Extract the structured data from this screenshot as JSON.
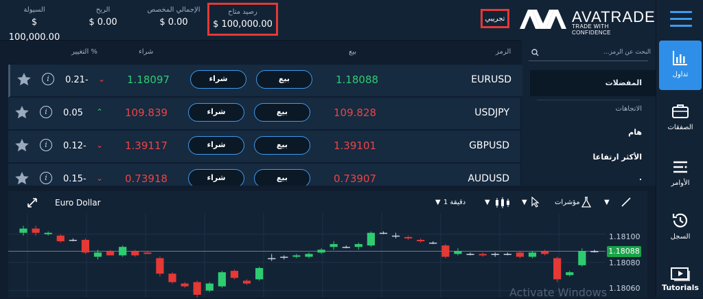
{
  "header": {
    "stats": [
      {
        "label": "السيولة",
        "value": "$ 100,000.00"
      },
      {
        "label": "الربح",
        "value": "$ 0.00"
      },
      {
        "label": "الإجمالي المخصص",
        "value": "$ 0.00"
      },
      {
        "label": "رصيد متاح",
        "value": "$ 100,000.00"
      }
    ],
    "demo_label": "تجريبي",
    "logo": {
      "brand": "AVATRADE",
      "tagline": "TRADE WITH CONFIDENCE"
    }
  },
  "nav": {
    "items": [
      {
        "label": "تداول",
        "icon": "bar-chart-icon"
      },
      {
        "label": "الصفقات",
        "icon": "briefcase-icon"
      },
      {
        "label": "الأوامر",
        "icon": "list-icon"
      },
      {
        "label": "السجل",
        "icon": "history-icon"
      },
      {
        "label": "Tutorials",
        "icon": "video-icon"
      }
    ]
  },
  "sidebar": {
    "search_placeholder": "البحث عن الرمز...",
    "favorites": "المفضلات",
    "trends_heading": "الاتجاهات",
    "items": [
      "هام",
      "الأكثر ارتفاعا",
      "."
    ]
  },
  "table": {
    "headers": {
      "symbol": "الرمز",
      "sell": "بيع",
      "buy": "شراء",
      "change": "التغيير %"
    },
    "buy_button": "شراء",
    "sell_button": "بيع",
    "rows": [
      {
        "symbol": "EURUSD",
        "sell": "1.18088",
        "buy": "1.18097",
        "change": "-0.21",
        "direction": "down",
        "color": "up"
      },
      {
        "symbol": "USDJPY",
        "sell": "109.828",
        "buy": "109.839",
        "change": "0.05",
        "direction": "up",
        "color": "down"
      },
      {
        "symbol": "GBPUSD",
        "sell": "1.39101",
        "buy": "1.39117",
        "change": "-0.12",
        "direction": "down",
        "color": "down"
      },
      {
        "symbol": "AUDUSD",
        "sell": "0.73907",
        "buy": "0.73918",
        "change": "-0.15",
        "direction": "down",
        "color": "down"
      }
    ]
  },
  "chart": {
    "title": "Euro Dollar",
    "timeframe": "1 دقيقة",
    "indicators_label": "مؤشرات",
    "current_price": "1.18088",
    "y_ticks": [
      "1.18100",
      "1.18080",
      "1.18060"
    ],
    "watermark": "Activate Windows",
    "colors": {
      "up": "#2ecc71",
      "down": "#e53935",
      "accent": "#3e9cf0"
    }
  },
  "chart_data": {
    "type": "candlestick",
    "title": "Euro Dollar",
    "y_ticks": [
      1.181,
      1.1808,
      1.1806
    ],
    "ylim": [
      1.18055,
      1.18115
    ],
    "current_price": 1.18088,
    "candles": [
      {
        "o": 1.18101,
        "c": 1.18104,
        "h": 1.18106,
        "l": 1.18099
      },
      {
        "o": 1.18104,
        "c": 1.18101,
        "h": 1.18106,
        "l": 1.18099
      },
      {
        "o": 1.181,
        "c": 1.18101,
        "h": 1.18102,
        "l": 1.18099
      },
      {
        "o": 1.18099,
        "c": 1.18095,
        "h": 1.181,
        "l": 1.18094
      },
      {
        "o": 1.18096,
        "c": 1.18096,
        "h": 1.18097,
        "l": 1.18095
      },
      {
        "o": 1.18096,
        "c": 1.18087,
        "h": 1.18097,
        "l": 1.18086
      },
      {
        "o": 1.18084,
        "c": 1.18087,
        "h": 1.18089,
        "l": 1.18082
      },
      {
        "o": 1.18088,
        "c": 1.18085,
        "h": 1.18089,
        "l": 1.18085
      },
      {
        "o": 1.18085,
        "c": 1.18091,
        "h": 1.18092,
        "l": 1.18084
      },
      {
        "o": 1.18088,
        "c": 1.18085,
        "h": 1.18089,
        "l": 1.18084
      },
      {
        "o": 1.18087,
        "c": 1.18086,
        "h": 1.18088,
        "l": 1.18086
      },
      {
        "o": 1.18083,
        "c": 1.18072,
        "h": 1.18084,
        "l": 1.1807
      },
      {
        "o": 1.18072,
        "c": 1.18066,
        "h": 1.18073,
        "l": 1.18065
      },
      {
        "o": 1.18065,
        "c": 1.18063,
        "h": 1.18066,
        "l": 1.18062
      },
      {
        "o": 1.18066,
        "c": 1.18057,
        "h": 1.18067,
        "l": 1.18055
      },
      {
        "o": 1.1806,
        "c": 1.18065,
        "h": 1.18066,
        "l": 1.18059
      },
      {
        "o": 1.18063,
        "c": 1.18073,
        "h": 1.18074,
        "l": 1.18062
      },
      {
        "o": 1.18074,
        "c": 1.18069,
        "h": 1.18075,
        "l": 1.18068
      },
      {
        "o": 1.18067,
        "c": 1.18065,
        "h": 1.18068,
        "l": 1.18064
      },
      {
        "o": 1.18068,
        "c": 1.18076,
        "h": 1.18077,
        "l": 1.18067
      },
      {
        "o": 1.18083,
        "c": 1.18083,
        "h": 1.18086,
        "l": 1.18081
      },
      {
        "o": 1.18084,
        "c": 1.18084,
        "h": 1.18085,
        "l": 1.18082
      },
      {
        "o": 1.18084,
        "c": 1.18085,
        "h": 1.18086,
        "l": 1.18083
      },
      {
        "o": 1.18084,
        "c": 1.18086,
        "h": 1.18087,
        "l": 1.18083
      },
      {
        "o": 1.18087,
        "c": 1.18089,
        "h": 1.1809,
        "l": 1.18086
      },
      {
        "o": 1.18091,
        "c": 1.18093,
        "h": 1.18095,
        "l": 1.18089
      },
      {
        "o": 1.18091,
        "c": 1.18091,
        "h": 1.18092,
        "l": 1.1809
      },
      {
        "o": 1.18091,
        "c": 1.18093,
        "h": 1.18094,
        "l": 1.18089
      },
      {
        "o": 1.18092,
        "c": 1.18101,
        "h": 1.18102,
        "l": 1.18091
      },
      {
        "o": 1.18101,
        "c": 1.18101,
        "h": 1.18102,
        "l": 1.181
      },
      {
        "o": 1.18099,
        "c": 1.18099,
        "h": 1.18101,
        "l": 1.18097
      },
      {
        "o": 1.18098,
        "c": 1.18097,
        "h": 1.18099,
        "l": 1.18096
      },
      {
        "o": 1.18096,
        "c": 1.18095,
        "h": 1.18097,
        "l": 1.18094
      },
      {
        "o": 1.18094,
        "c": 1.18094,
        "h": 1.18095,
        "l": 1.18093
      },
      {
        "o": 1.18092,
        "c": 1.18084,
        "h": 1.18093,
        "l": 1.18083
      },
      {
        "o": 1.18086,
        "c": 1.18088,
        "h": 1.1809,
        "l": 1.18085
      },
      {
        "o": 1.18086,
        "c": 1.18086,
        "h": 1.18087,
        "l": 1.18085
      },
      {
        "o": 1.18086,
        "c": 1.18085,
        "h": 1.18087,
        "l": 1.18084
      },
      {
        "o": 1.18086,
        "c": 1.18086,
        "h": 1.18087,
        "l": 1.18084
      },
      {
        "o": 1.18086,
        "c": 1.18086,
        "h": 1.18087,
        "l": 1.18085
      },
      {
        "o": 1.18087,
        "c": 1.18084,
        "h": 1.18088,
        "l": 1.18083
      },
      {
        "o": 1.18084,
        "c": 1.18087,
        "h": 1.18088,
        "l": 1.18083
      },
      {
        "o": 1.18088,
        "c": 1.18086,
        "h": 1.18089,
        "l": 1.18085
      },
      {
        "o": 1.18083,
        "c": 1.18068,
        "h": 1.18084,
        "l": 1.18066
      },
      {
        "o": 1.18071,
        "c": 1.18073,
        "h": 1.18074,
        "l": 1.1807
      },
      {
        "o": 1.18078,
        "c": 1.18088,
        "h": 1.1809,
        "l": 1.18077
      },
      {
        "o": 1.18088,
        "c": 1.18088,
        "h": 1.18089,
        "l": 1.18087
      }
    ]
  }
}
